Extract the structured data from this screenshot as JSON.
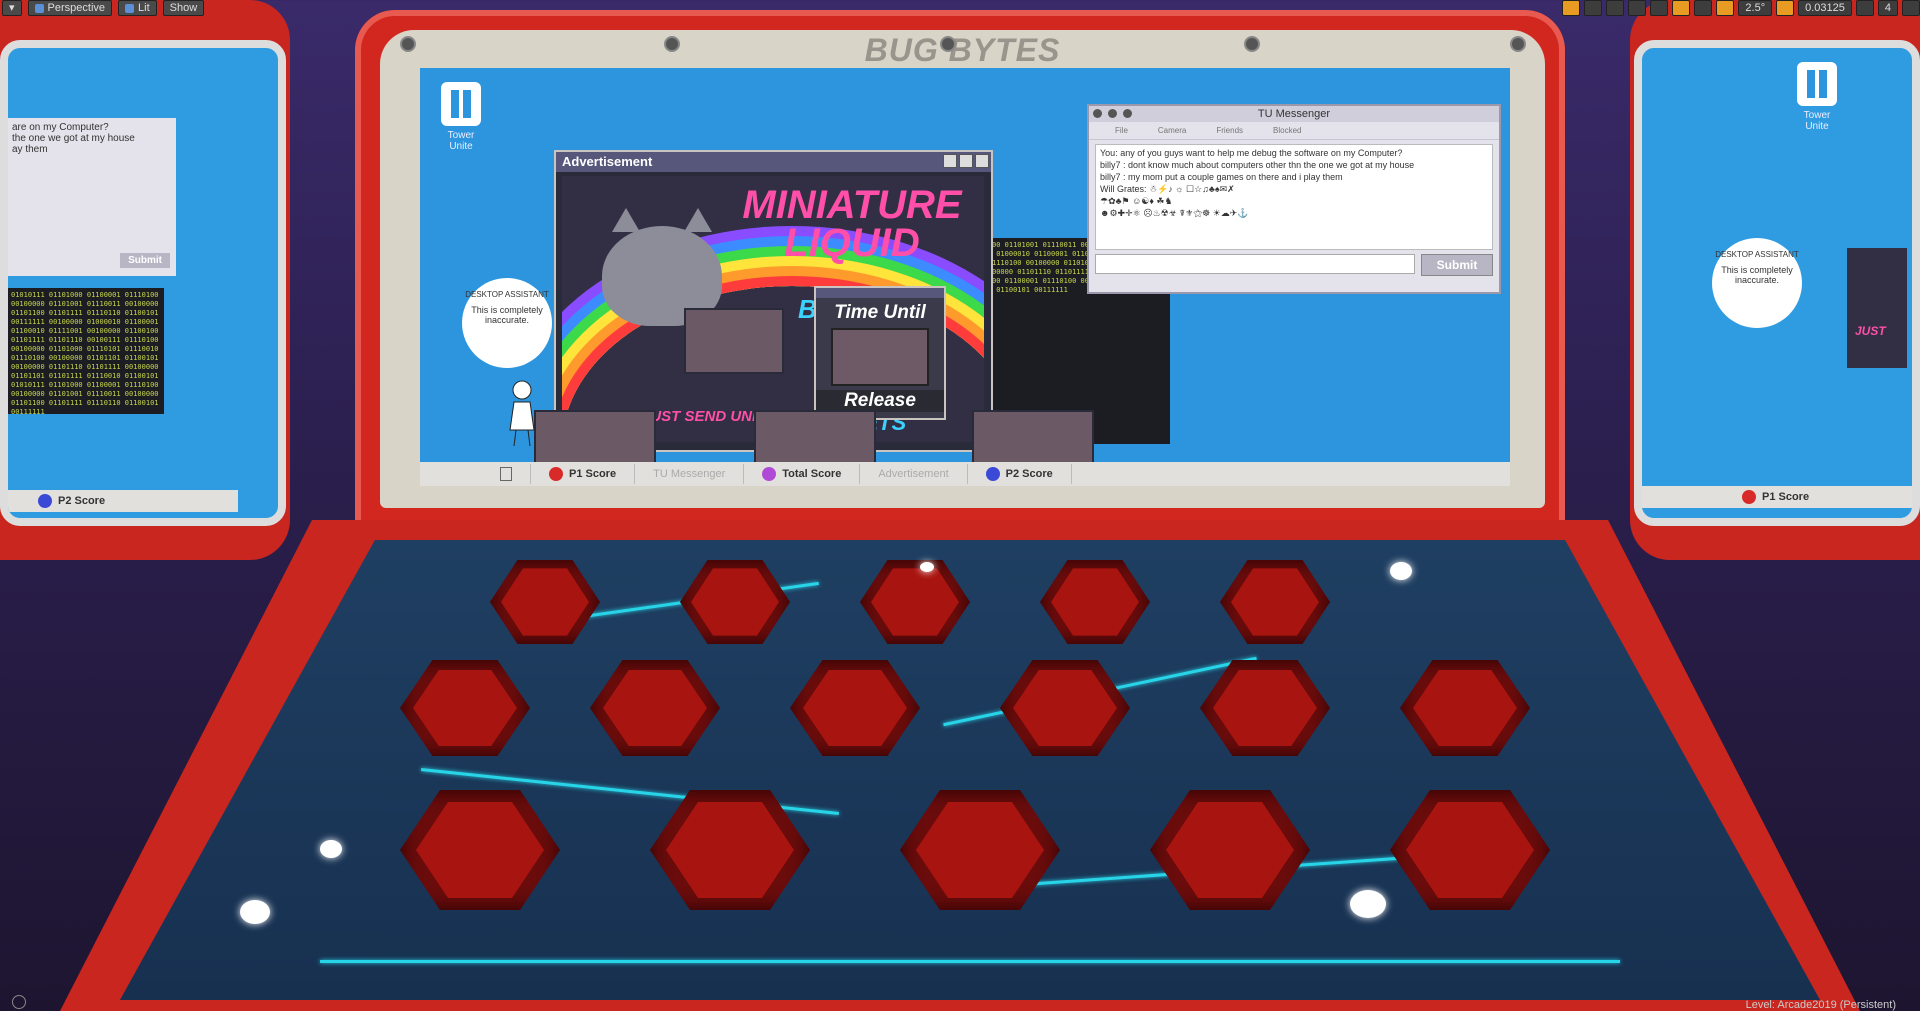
{
  "viewport": {
    "mode": "Perspective",
    "lighting": "Lit",
    "show": "Show",
    "grid_snap": "2.5°",
    "scale_snap": "0.03125",
    "camera_speed": "4",
    "level_label": "Level: Arcade2019 (Persistent)"
  },
  "cabinet": {
    "brand": "BUG BYTES",
    "desktop": {
      "logo_label": "Tower Unite",
      "assistant_title": "DESKTOP ASSISTANT",
      "assistant_text": "This is completely inaccurate."
    },
    "advertisement": {
      "title": "Advertisement",
      "headline": "MINIATURE LIQUID",
      "bonus": "BONUS",
      "tickets": "TICKETS",
      "send": "JUST SEND UNITS"
    },
    "timer": {
      "line1": "Time Until",
      "line2": "Release"
    },
    "messenger": {
      "title": "TU Messenger",
      "menu": [
        "File",
        "Camera",
        "Friends",
        "Blocked"
      ],
      "lines": [
        "You: any of you guys want to help me debug  the software on my Computer?",
        "billy7 : dont know much about computers other thn the one we got at my house",
        "billy7 : my mom put a couple games on there and i play them",
        "Will Grates: ☃⚡♪ ☼ ☐☆♫♣♠✉✗",
        "☂✿♣⚑ ☺☯♦ ☘♞",
        "☻⚙✚✛⚛ ☹♨☢☣ ☤⚜⚝☸ ☀☁✈⚓"
      ],
      "submit": "Submit"
    },
    "code_text": "01010111 01101000 01100001 01110100 00100000 01101001 01110011 00100000 01101100 01101111 01110110 01100101 00111111 00100000 01000010 01100001 01100010 01111001 00100000 01100100 01101111 01101110 00100111 01110100 00100000 01101000 01110101 01110010 01110100 00100000 01101101 01100101 00100000 01101110 01101111 00100000 01101101 01101111 01110010 01100101 01010111 01101000 01100001 01110100 00100000 01101001 01110011 00100000 01101100 01101111 01110110 01100101 00111111",
    "taskbar": {
      "p1": "P1 Score",
      "messenger": "TU Messenger",
      "total": "Total Score",
      "advertisement": "Advertisement",
      "p2": "P2 Score"
    },
    "colors": {
      "p1": "#d92a2a",
      "total": "#b04ad6",
      "p2": "#3a4ad6"
    }
  },
  "side_cabinets": {
    "left_taskbar": "P2 Score",
    "left_submit": "Submit",
    "left_msg_fragments": [
      "are on my Computer?",
      "the one we got at my house",
      "ay them"
    ],
    "right_taskbar": "P1 Score",
    "right_logo_label": "Tower Unite",
    "right_assistant_title": "DESKTOP ASSISTANT",
    "right_assistant_text": "This is completely inaccurate.",
    "right_send": "JUST"
  }
}
